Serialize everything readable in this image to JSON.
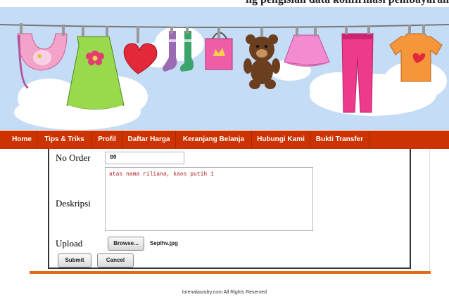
{
  "nav": {
    "items": [
      "Home",
      "Tips & Triks",
      "Profil",
      "Daftar Harga",
      "Keranjang Belanja",
      "Hubungi Kami",
      "Bukti Transfer"
    ]
  },
  "form": {
    "no_order_label": "No Order",
    "no_order_value": "80",
    "deskripsi_label": "Deskripsi",
    "deskripsi_value": "atas nama riliana, kaos putih 1",
    "upload_label": "Upload",
    "browse_label": "Browse...",
    "file_name": "Seplhv.jpg",
    "submit_label": "Submit",
    "cancel_label": "Cancel"
  },
  "footer": {
    "text": "lorenalaundry.com All Rights Reserved"
  },
  "colors": {
    "nav_bg": "#cc3300",
    "sky": "#c4dcf6",
    "divider": "#e06a1a"
  }
}
